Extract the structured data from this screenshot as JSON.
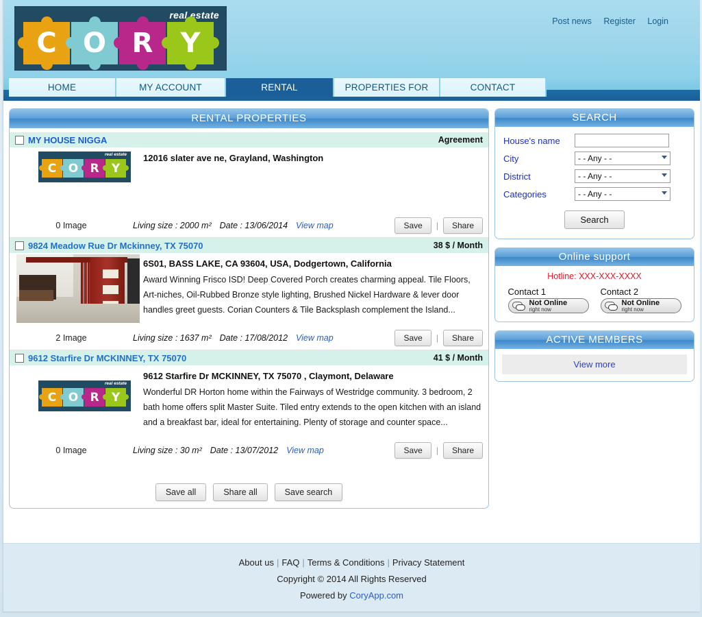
{
  "header": {
    "logo": {
      "tagline": "real estate",
      "letters": [
        "C",
        "O",
        "R",
        "Y"
      ]
    },
    "top_links": [
      {
        "label": "Post news"
      },
      {
        "label": "Register"
      },
      {
        "label": "Login"
      }
    ]
  },
  "nav": {
    "tabs": [
      {
        "label": "HOME",
        "active": false
      },
      {
        "label": "MY ACCOUNT",
        "active": false
      },
      {
        "label": "RENTAL PROPERTIES",
        "active": true
      },
      {
        "label": "PROPERTIES FOR SELL",
        "active": false
      },
      {
        "label": "CONTACT",
        "active": false
      }
    ]
  },
  "main": {
    "panel_title": "RENTAL PROPERTIES",
    "listings": [
      {
        "title": "MY HOUSE NIGGA",
        "price": "Agreement",
        "address": "12016 slater ave ne, Grayland, Washington",
        "description": "",
        "image_count": "0 Image",
        "living_size": "Living size : 2000 m²",
        "date": "Date : 13/06/2014",
        "map_link": "View map",
        "save_label": "Save",
        "share_label": "Share",
        "thumb_type": "logo"
      },
      {
        "title": "9824 Meadow Rue Dr Mckinney, TX 75070",
        "price": "38 $ / Month",
        "address": "6S01, BASS LAKE, CA 93604, USA, Dodgertown, California",
        "description": "Award Winning Frisco ISD! Deep Covered Porch creates charming appeal. Tile Floors, Art-niches, Oil-Rubbed Bronze style lighting, Brushed Nickel Hardware & lever door handles greet guests. Corian Counters & Tile Backsplash complement the Island...",
        "image_count": "2 Image",
        "living_size": "Living size : 1637 m²",
        "date": "Date : 17/08/2012",
        "map_link": "View map",
        "save_label": "Save",
        "share_label": "Share",
        "thumb_type": "photo"
      },
      {
        "title": "9612 Starfire Dr MCKINNEY, TX 75070",
        "price": "41 $ / Month",
        "address": "9612 Starfire Dr MCKINNEY, TX 75070 , Claymont, Delaware",
        "description": "Wonderful DR Horton home within the Fairways of Westridge community. 3 bedroom, 2 bath home offers split Master Suite. Tiled entry extends to the open kitchen with an island and a breakfast bar, ideal for entertaining. Plenty of storage and counter space...",
        "image_count": "0 Image",
        "living_size": "Living size : 30 m²",
        "date": "Date : 13/07/2012",
        "map_link": "View map",
        "save_label": "Save",
        "share_label": "Share",
        "thumb_type": "logo"
      }
    ],
    "bulk_actions": [
      {
        "label": "Save all"
      },
      {
        "label": "Share all"
      },
      {
        "label": "Save search"
      }
    ]
  },
  "sidebar": {
    "search": {
      "title": "SEARCH",
      "fields": [
        {
          "label": "House's name",
          "type": "text",
          "value": "",
          "placeholder": ""
        },
        {
          "label": "City",
          "type": "select",
          "value": "- - Any - -"
        },
        {
          "label": "District",
          "type": "select",
          "value": "- - Any - -"
        },
        {
          "label": "Categories",
          "type": "select",
          "value": "- - Any - -"
        }
      ],
      "button_label": "Search"
    },
    "support": {
      "title": "Online support",
      "hotline": "Hotline: XXX-XXX-XXXX",
      "contacts": [
        {
          "name": "Contact 1",
          "status_main": "Not Online",
          "status_sub": "right now"
        },
        {
          "name": "Contact 2",
          "status_main": "Not Online",
          "status_sub": "right now"
        }
      ]
    },
    "members": {
      "title": "ACTIVE MEMBERS",
      "view_more": "View more"
    }
  },
  "footer": {
    "links": [
      {
        "label": "About us"
      },
      {
        "label": "FAQ"
      },
      {
        "label": "Terms & Conditions"
      },
      {
        "label": "Privacy Statement"
      }
    ],
    "copyright": "Copyright © 2014 All Rights Reserved",
    "powered_prefix": "Powered by",
    "powered_link": "CoryApp.com"
  },
  "colors": {
    "header_blue": "#8fd2ea",
    "nav_active": "#1a5f97",
    "link_blue": "#1a5fd0",
    "hotline_red": "#e2182b",
    "listing_head_bg": "#d6f0ea"
  }
}
